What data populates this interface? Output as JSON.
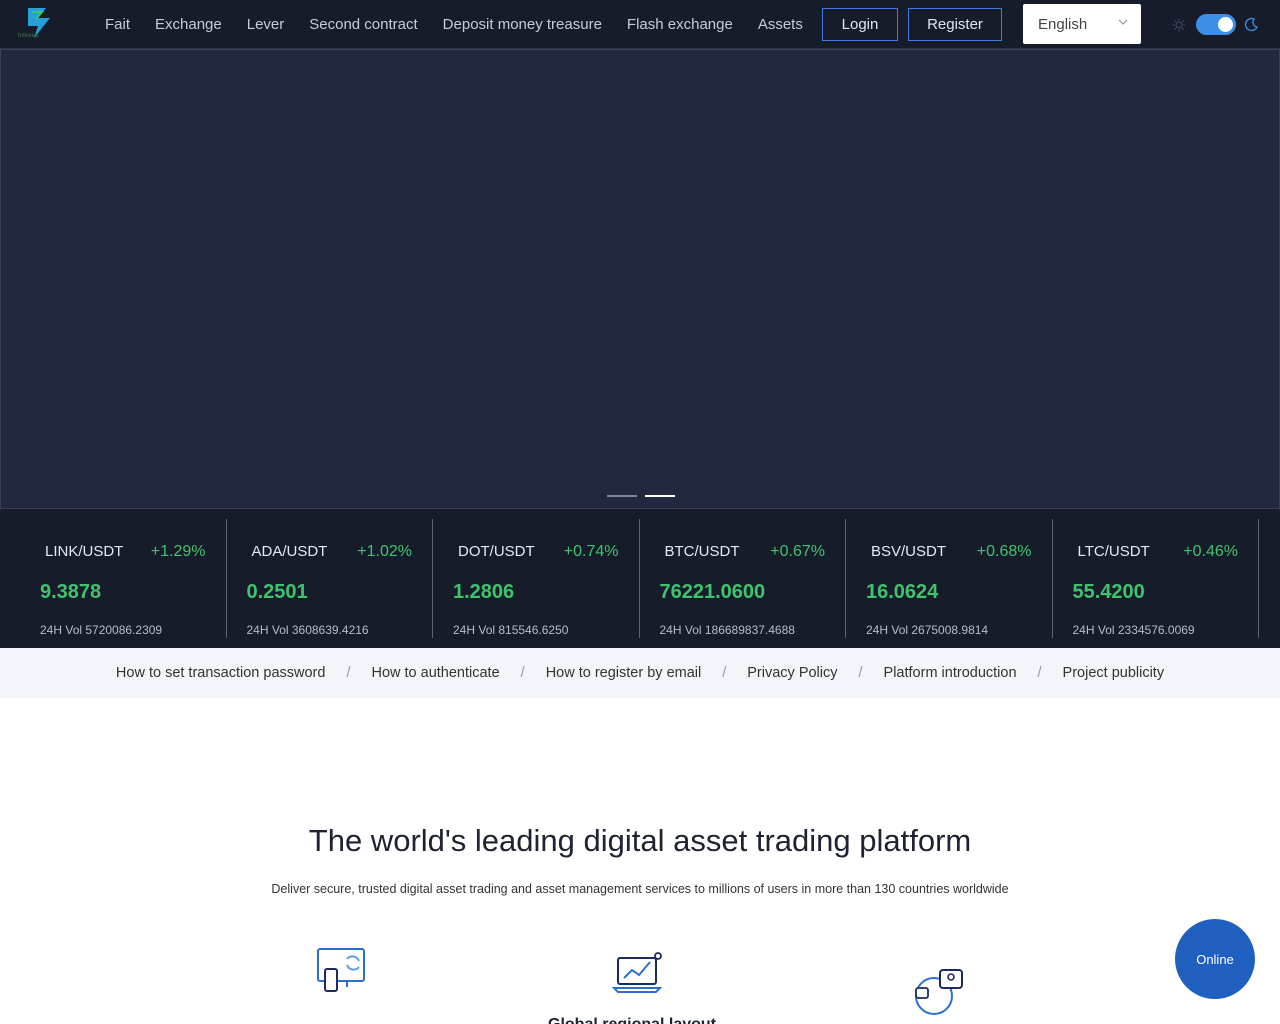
{
  "header": {
    "logo_text": "bitkeep",
    "nav": [
      "Fait",
      "Exchange",
      "Lever",
      "Second contract",
      "Deposit money treasure",
      "Flash exchange",
      "Assets"
    ],
    "login_label": "Login",
    "register_label": "Register",
    "language": "English",
    "theme_toggle": "dark"
  },
  "ticker": [
    {
      "pair": "LINK/USDT",
      "change": "+1.29%",
      "price": "9.3878",
      "volume": "24H Vol 5720086.2309"
    },
    {
      "pair": "ADA/USDT",
      "change": "+1.02%",
      "price": "0.2501",
      "volume": "24H Vol 3608639.4216"
    },
    {
      "pair": "DOT/USDT",
      "change": "+0.74%",
      "price": "1.2806",
      "volume": "24H Vol 815546.6250"
    },
    {
      "pair": "BTC/USDT",
      "change": "+0.67%",
      "price": "76221.0600",
      "volume": "24H Vol 186689837.4688"
    },
    {
      "pair": "BSV/USDT",
      "change": "+0.68%",
      "price": "16.0624",
      "volume": "24H Vol 2675008.9814"
    },
    {
      "pair": "LTC/USDT",
      "change": "+0.46%",
      "price": "55.4200",
      "volume": "24H Vol 2334576.0069"
    }
  ],
  "links": [
    "How to set transaction password",
    "How to authenticate",
    "How to register by email",
    "Privacy Policy",
    "Platform introduction",
    "Project publicity"
  ],
  "link_separator": "/",
  "main": {
    "headline": "The world's leading digital asset trading platform",
    "subline": "Deliver secure, trusted digital asset trading and asset management services to millions of users in more than 130 countries worldwide",
    "feature_title_partial": "Global regional layout"
  },
  "online_label": "Online",
  "colors": {
    "header_bg": "#171c2b",
    "banner_bg": "#222840",
    "positive": "#3ec46d",
    "accent": "#3f7be0",
    "online_button": "#1f5fbf"
  },
  "icons": [
    "bitkeep-logo-icon",
    "chevron-down-icon",
    "sun-icon",
    "moon-icon",
    "device-sync-icon",
    "chart-laptop-icon",
    "global-users-icon"
  ]
}
